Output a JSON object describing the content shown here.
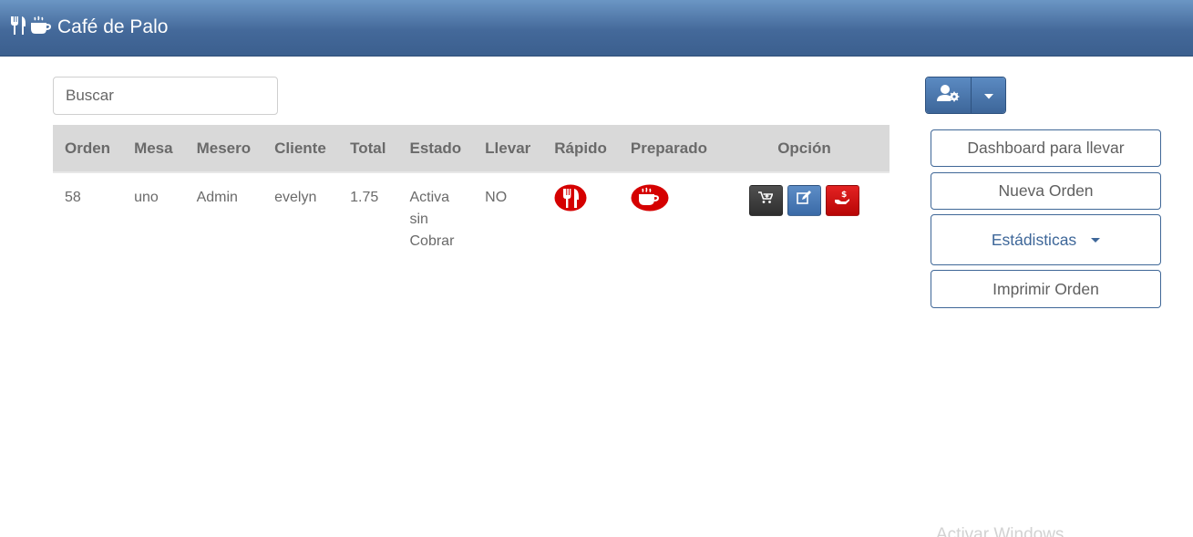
{
  "navbar": {
    "title": "Café de Palo",
    "icons": [
      "utensils-icon",
      "coffee-icon"
    ]
  },
  "search": {
    "placeholder": "Buscar",
    "value": ""
  },
  "table": {
    "headers": [
      "Orden",
      "Mesa",
      "Mesero",
      "Cliente",
      "Total",
      "Estado",
      "Llevar",
      "Rápido",
      "Preparado",
      "Opción"
    ],
    "rows": [
      {
        "orden": "58",
        "mesa": "uno",
        "mesero": "Admin",
        "cliente": "evelyn",
        "total": "1.75",
        "estado": [
          "Activa",
          "sin",
          "Cobrar"
        ],
        "llevar": "NO",
        "rapido_icon": "utensils-icon",
        "preparado_icon": "coffee-icon",
        "opciones": [
          "cart-icon",
          "edit-icon",
          "hand-money-icon"
        ]
      }
    ]
  },
  "user_menu": {
    "icon": "user-cog-icon",
    "caret_icon": "caret-down-icon"
  },
  "sidebar": {
    "dashboard_label": "Dashboard para llevar",
    "nueva_orden_label": "Nueva Orden",
    "estadisticas_label": "Estádisticas",
    "imprimir_label": "Imprimir Orden"
  },
  "colors": {
    "navbar": "#44699a",
    "accent_blue": "#3e6799",
    "status_red": "#d50000",
    "header_row": "#d9d9d9"
  },
  "watermark": "Activar Windows"
}
